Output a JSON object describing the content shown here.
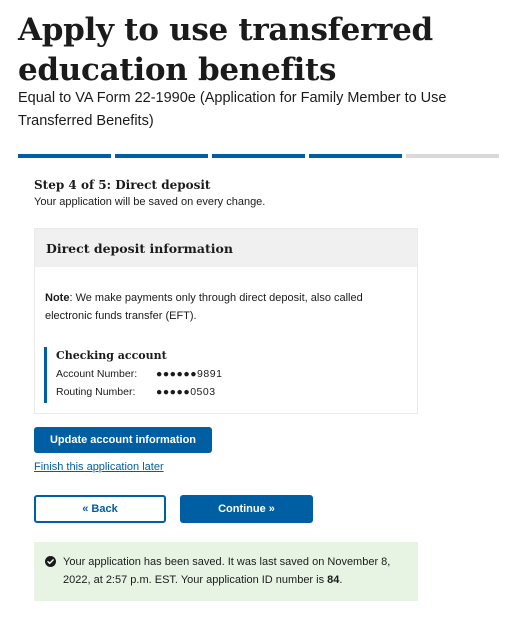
{
  "header": {
    "title": "Apply to use transferred education benefits",
    "subtitle": "Equal to VA Form 22-1990e (Application for Family Member to Use Transferred Benefits)"
  },
  "progress": {
    "current_step": 4,
    "total_steps": 5
  },
  "step": {
    "title": "Step 4 of 5: Direct deposit",
    "save_note": "Your application will be saved on every change."
  },
  "direct_deposit": {
    "heading": "Direct deposit information",
    "note_label": "Note",
    "note_text": ": We make payments only through direct deposit, also called electronic funds transfer (EFT).",
    "account": {
      "title": "Checking account",
      "account_number_label": "Account Number:",
      "account_number_value": "●●●●●●9891",
      "routing_number_label": "Routing Number:",
      "routing_number_value": "●●●●●0503"
    }
  },
  "actions": {
    "update_label": "Update account information",
    "finish_later_label": "Finish this application later",
    "back_label": "« Back",
    "continue_label": "Continue »"
  },
  "alert": {
    "text_before": "Your application has been saved. It was last saved on November 8, 2022, at 2:57 p.m. EST. Your application ID number is ",
    "application_id": "84",
    "text_after": "."
  },
  "colors": {
    "primary": "#005ea2",
    "success_bg": "#e7f4e4",
    "progress_incomplete": "#d9d9d9"
  }
}
